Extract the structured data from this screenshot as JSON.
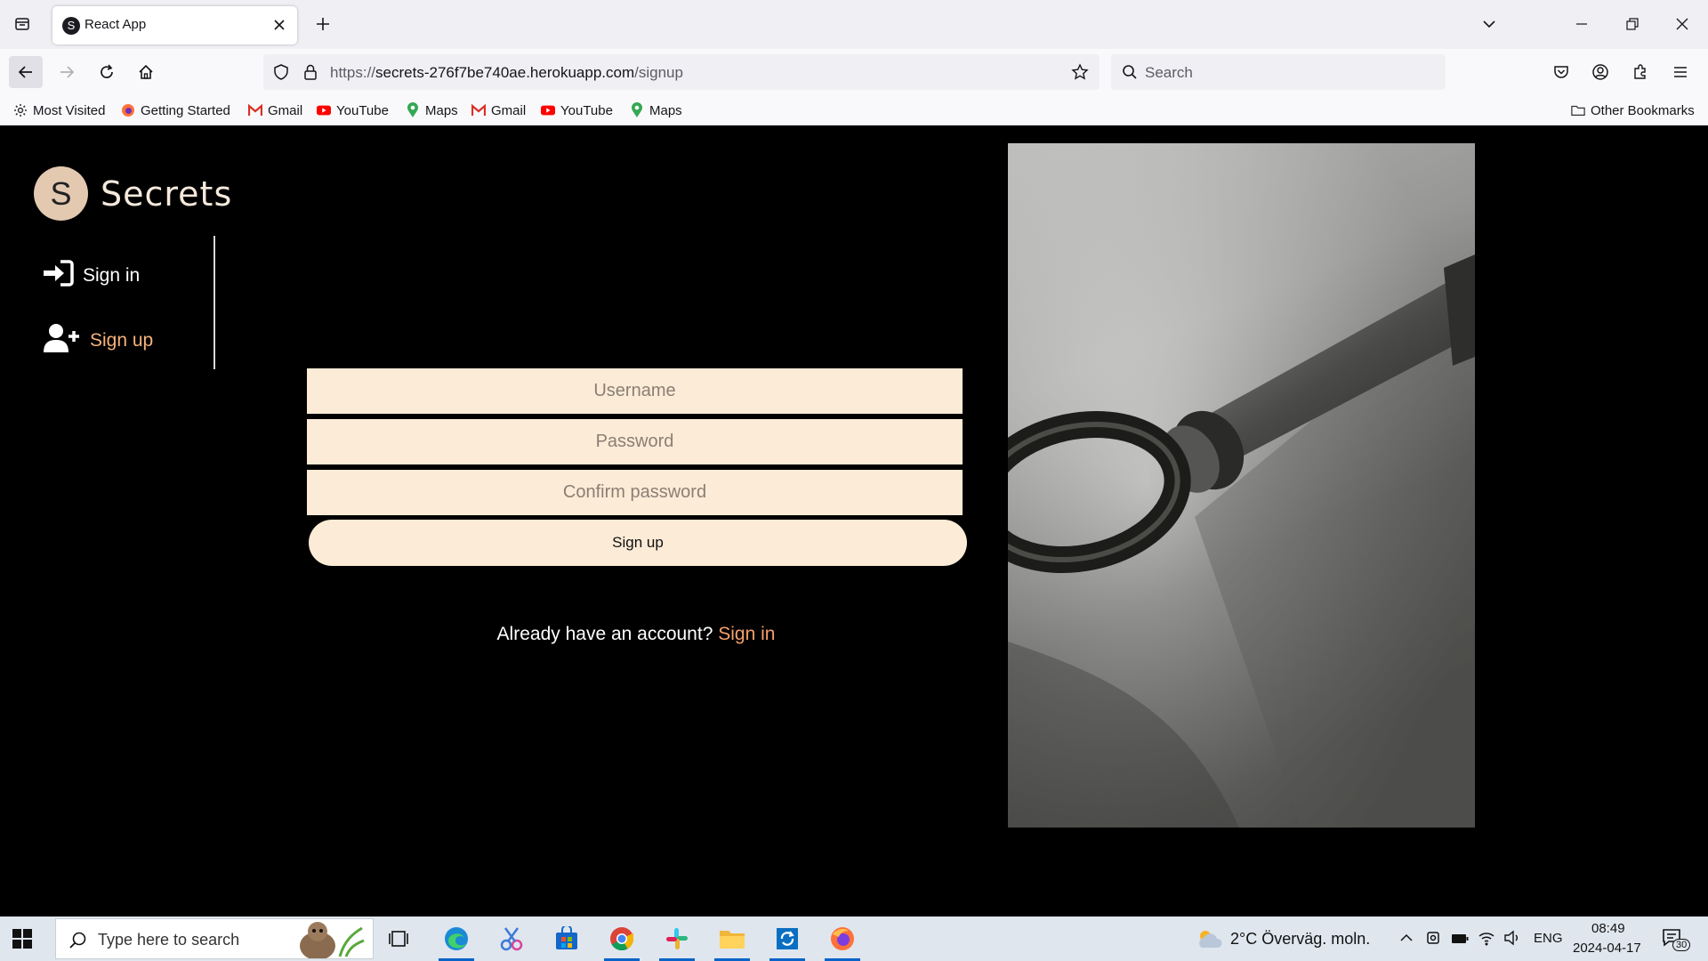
{
  "browser": {
    "tab": {
      "favicon_letter": "S",
      "title": "React App"
    },
    "url": {
      "prefix": "https://",
      "host": "secrets-276f7be740ae.herokuapp.com",
      "path": "/signup"
    },
    "search_placeholder": "Search",
    "bookmarks": [
      {
        "label": "Most Visited",
        "icon": "gear-icon"
      },
      {
        "label": "Getting Started",
        "icon": "firefox-icon"
      },
      {
        "label": "Gmail",
        "icon": "gmail-icon"
      },
      {
        "label": "YouTube",
        "icon": "youtube-icon"
      },
      {
        "label": "Maps",
        "icon": "maps-icon"
      },
      {
        "label": "Gmail",
        "icon": "gmail-icon"
      },
      {
        "label": "YouTube",
        "icon": "youtube-icon"
      },
      {
        "label": "Maps",
        "icon": "maps-icon"
      }
    ],
    "other_bookmarks": "Other Bookmarks"
  },
  "app": {
    "logo_letter": "S",
    "brand": "Secrets",
    "nav": {
      "signin": "Sign in",
      "signup": "Sign up"
    },
    "form": {
      "username_placeholder": "Username",
      "password_placeholder": "Password",
      "confirm_placeholder": "Confirm password",
      "submit_label": "Sign up"
    },
    "account_prompt": "Already have an account?",
    "account_link": "Sign in",
    "colors": {
      "accent": "#f6b27a",
      "field_bg": "#fcebd6",
      "logo_bg": "#e4c9b1"
    }
  },
  "taskbar": {
    "search_placeholder": "Type here to search",
    "weather": "2°C  Överväg. moln.",
    "language": "ENG",
    "time": "08:49",
    "date": "2024-04-17",
    "notifications": "30"
  }
}
